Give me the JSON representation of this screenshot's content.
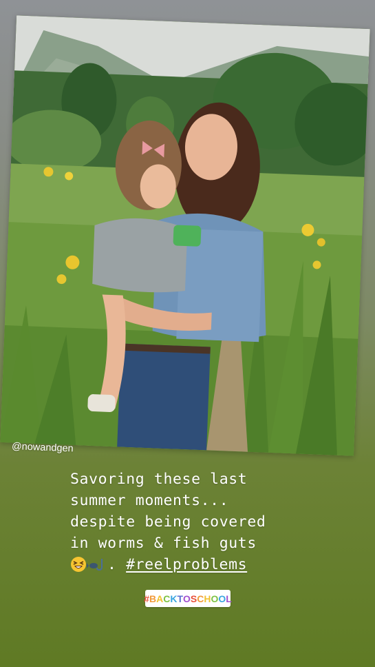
{
  "story": {
    "mention": "@nowandgen",
    "caption_lines": [
      "Savoring these last",
      "summer moments...",
      "despite being covered",
      "in worms & fish guts"
    ],
    "caption_end_punct": ".",
    "hashtag": "#reelproblems",
    "sticker_text": "#BACKTOSCHOOL",
    "sticker_colors": [
      "#e8503a",
      "#f29a3a",
      "#f2c230",
      "#7dc243",
      "#3aa6e0",
      "#5a6fd0",
      "#a14fcf",
      "#e8503a",
      "#f29a3a",
      "#f2c230",
      "#7dc243",
      "#3aa6e0",
      "#a14fcf"
    ]
  },
  "icons": {
    "laugh": "grinning-squinting-face-icon",
    "fish": "fish-hook-icon"
  },
  "colors": {
    "bg_top": "#8f9296",
    "bg_bottom": "#5f7a24",
    "text": "#ffffff"
  }
}
